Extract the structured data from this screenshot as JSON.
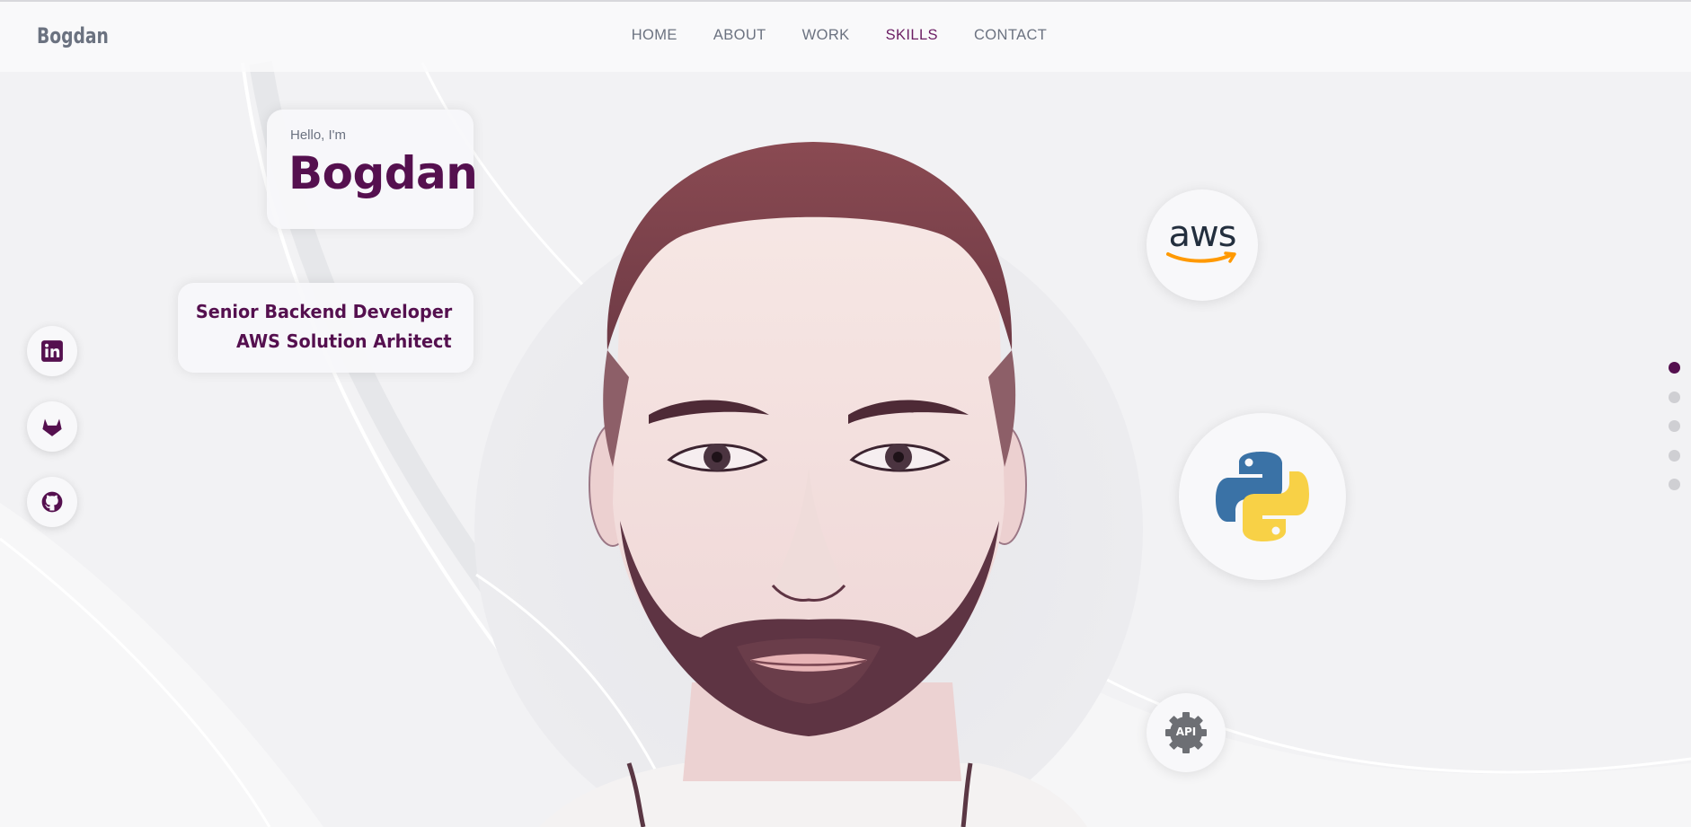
{
  "nav": {
    "logo": "Bogdan",
    "links": [
      {
        "label": "HOME"
      },
      {
        "label": "ABOUT"
      },
      {
        "label": "WORK"
      },
      {
        "label": "SKILLS"
      },
      {
        "label": "CONTACT"
      }
    ],
    "active": "SKILLS"
  },
  "intro": {
    "greeting": "Hello, I'm",
    "name": "Bogdan",
    "roles": [
      "Senior Backend Developer",
      "AWS Solution Arhitect"
    ]
  },
  "social": [
    {
      "icon": "linkedin-icon"
    },
    {
      "icon": "gitlab-icon"
    },
    {
      "icon": "github-icon"
    }
  ],
  "skills": [
    {
      "icon": "aws-icon",
      "label": "aws"
    },
    {
      "icon": "python-icon"
    },
    {
      "icon": "api-icon",
      "label": "API"
    }
  ],
  "pagination": {
    "count": 5,
    "active_index": 0
  },
  "colors": {
    "accent": "#55104f",
    "nav_text": "#6b7280",
    "background": "#f1f1f3"
  }
}
